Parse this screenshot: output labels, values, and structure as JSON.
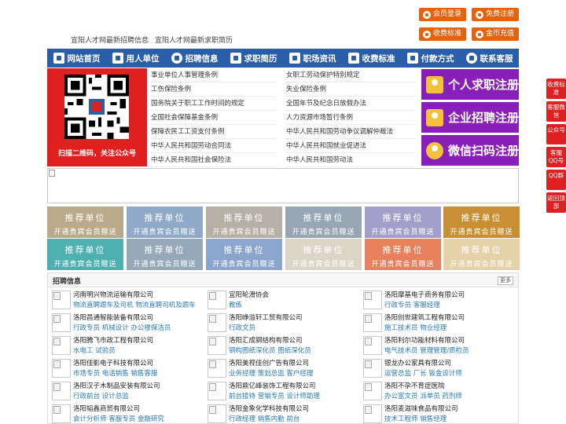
{
  "topbar": {
    "buttons": [
      {
        "label": "会员登录",
        "icon": "user-icon"
      },
      {
        "label": "免费注册",
        "icon": "register-icon"
      },
      {
        "label": "收费标准",
        "icon": "price-icon"
      },
      {
        "label": "金币充值",
        "icon": "coin-icon"
      }
    ],
    "links": [
      "宜阳人才网最新招聘信息",
      "宜阳人才网最新求职简历"
    ]
  },
  "nav": {
    "items": [
      {
        "label": "网站首页",
        "icon": "home-icon"
      },
      {
        "label": "用人单位",
        "icon": "building-icon"
      },
      {
        "label": "招聘信息",
        "icon": "chat-icon"
      },
      {
        "label": "求职简历",
        "icon": "resume-icon"
      },
      {
        "label": "职场资讯",
        "icon": "news-icon"
      },
      {
        "label": "收费标准",
        "icon": "price-icon"
      },
      {
        "label": "付款方式",
        "icon": "payment-icon"
      },
      {
        "label": "联系客服",
        "icon": "phone-icon"
      }
    ]
  },
  "qr": {
    "caption": "扫描二维码，关注公众号"
  },
  "laws": {
    "left": [
      "事业单位人事管理条例",
      "工伤保险条例",
      "国务院关于职工工作时间的规定",
      "全国社会保障基金条例",
      "保障农民工工资支付条例",
      "中华人民共和国劳动合同法",
      "中华人民共和国社会保险法"
    ],
    "right": [
      "女职工劳动保护特别规定",
      "失业保险条例",
      "全国年节及纪念日放假办法",
      "人力资源市场暂行条例",
      "中华人民共和国劳动争议调解仲裁法",
      "中华人民共和国就业促进法",
      "中华人民共和国劳动法"
    ]
  },
  "register": [
    {
      "label": "个人求职注册",
      "icon": "person-icon"
    },
    {
      "label": "企业招聘注册",
      "icon": "company-icon"
    },
    {
      "label": "微信扫码注册",
      "icon": "wechat-icon"
    }
  ],
  "recommend": {
    "title": "推荐单位",
    "subtitle": "开通贵宾会员赠送",
    "colors": [
      "#b9ab8a",
      "#8fa9c9",
      "#b6b0a6",
      "#98a5b2",
      "#a39fca",
      "#c89034",
      "#4fb0b1",
      "#96a9b9",
      "#8ba6cc",
      "#dcd6c9",
      "#e8805e",
      "#e6d2a8"
    ]
  },
  "jobs": {
    "title": "招聘信息",
    "more": "更多",
    "columns": [
      [
        {
          "company": "河南明兴物流运输有限公司",
          "positions": "物流直聘跟车及司机 物流直聘司机及跟车"
        },
        {
          "company": "洛阳昌通智能装备有限公司",
          "positions": "行政专员 机械设计 办公楼保洁员"
        },
        {
          "company": "洛阳腾飞市政工程有限公司",
          "positions": "水电工 试验员"
        },
        {
          "company": "洛阳佳影电子科技有限公司",
          "positions": "市场专员 电话销售 销售客服"
        },
        {
          "company": "洛阳汉子木制品安装有限公司",
          "positions": "行政前台 设计总监"
        },
        {
          "company": "洛阳韬鑫商贸有限公司",
          "positions": "会计分析师 客服专员 金融研究"
        }
      ],
      [
        {
          "company": "宜阳轮滑协会",
          "positions": "教练"
        },
        {
          "company": "洛阳峥溢轩工贸有限公司",
          "positions": "行政文员"
        },
        {
          "company": "洛阳汇成钢结构有限公司",
          "positions": "钢构图纸深化员 图纸深化员"
        },
        {
          "company": "洛阳美视佳创广告有限公司",
          "positions": "业务经理 策划总监 客户经理"
        },
        {
          "company": "洛阳鼎亿峰装饰工程有限公司",
          "positions": "前台接待 营销专员 设计师助理"
        },
        {
          "company": "洛阳金象化学科技有限公司",
          "positions": "行政经理 销售内勤 前台"
        }
      ],
      [
        {
          "company": "洛阳摩基电子商务有限公司",
          "positions": "行政专员 客服经理"
        },
        {
          "company": "洛阳创世建筑工程有限公司",
          "positions": "施工技术员 物业经理"
        },
        {
          "company": "洛阳利尔功能材料有限公司",
          "positions": "电气技术员 管理管理/质检员"
        },
        {
          "company": "银龙办公家具有限公司",
          "positions": "运营总监 厂长 钣金设计师"
        },
        {
          "company": "洛阳不孕不育症医院",
          "positions": "办公室文员 派单员 药剂师"
        },
        {
          "company": "洛阳麦滋味食品有限公司",
          "positions": "技术工程师 销售经理"
        }
      ]
    ]
  },
  "side": [
    {
      "label": "收费标准",
      "icon": "price-icon"
    },
    {
      "label": "客服微信",
      "icon": "wechat-icon"
    },
    {
      "label": "公众号",
      "icon": "account-icon"
    },
    {
      "label": "客服QQ号",
      "icon": "qq-icon"
    },
    {
      "label": "QQ群",
      "icon": "qq-group-icon"
    },
    {
      "label": "返回顶部",
      "icon": "top-icon"
    }
  ]
}
